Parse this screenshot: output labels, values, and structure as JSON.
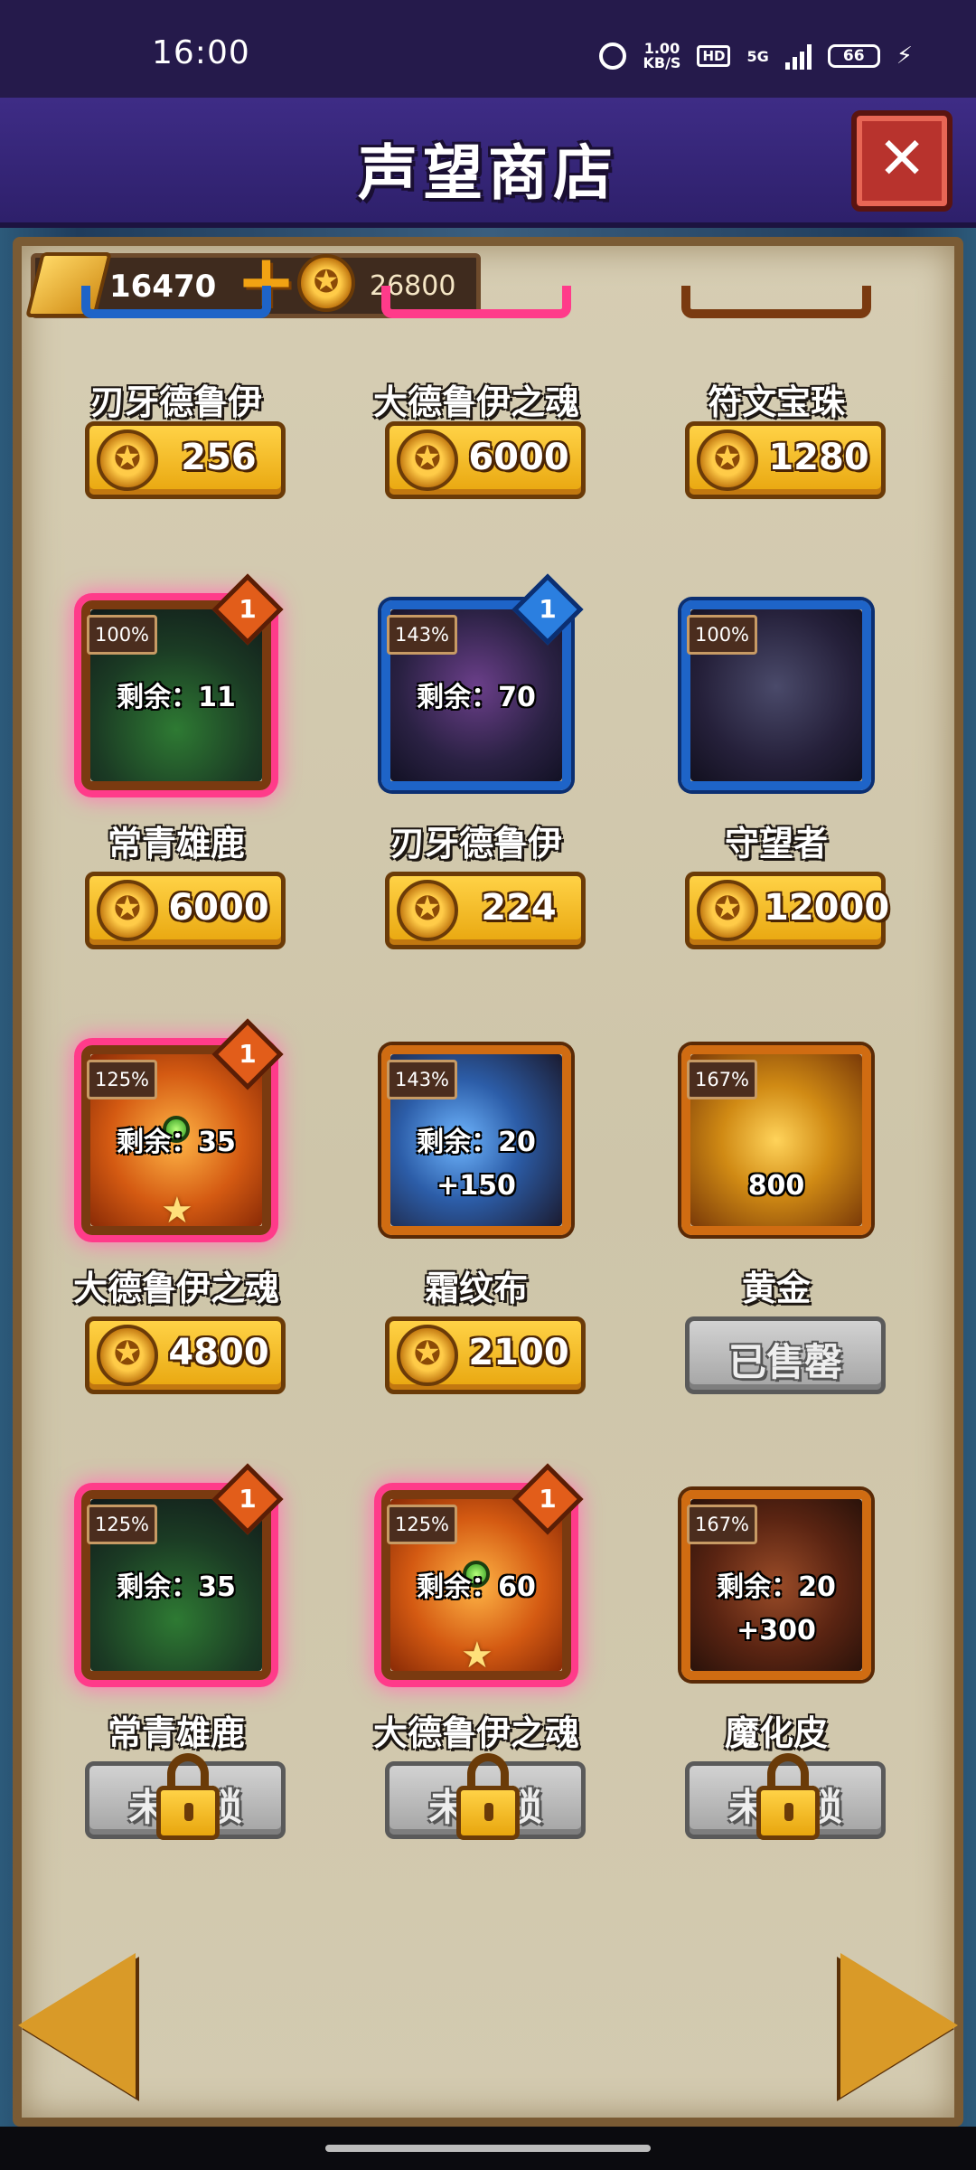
{
  "status": {
    "time": "16:00",
    "speed_value": "1.00",
    "speed_unit": "KB/S",
    "hd": "HD",
    "network": "5G",
    "battery": "66"
  },
  "title": "声望商店",
  "currency": {
    "gold": "16470",
    "coins": "26800"
  },
  "top_row": [
    {
      "name": "刃牙德鲁伊",
      "price": "256"
    },
    {
      "name": "大德鲁伊之魂",
      "price": "6000"
    },
    {
      "name": "符文宝珠",
      "price": "1280"
    }
  ],
  "items": [
    {
      "name": "常青雄鹿",
      "pct": "100%",
      "badge": "1",
      "remain": "剩余：11",
      "price": "6000"
    },
    {
      "name": "刃牙德鲁伊",
      "pct": "143%",
      "badge": "1",
      "remain": "剩余：70",
      "price": "224"
    },
    {
      "name": "守望者",
      "pct": "100%",
      "price": "12000"
    },
    {
      "name": "大德鲁伊之魂",
      "pct": "125%",
      "badge": "1",
      "remain": "剩余：35",
      "price": "4800"
    },
    {
      "name": "霜纹布",
      "pct": "143%",
      "remain": "剩余：20",
      "qty": "+150",
      "price": "2100"
    },
    {
      "name": "黄金",
      "pct": "167%",
      "qty": "800",
      "sold_label": "已售罄"
    },
    {
      "name": "常青雄鹿",
      "pct": "125%",
      "badge": "1",
      "remain": "剩余：35",
      "locked_label": "未解锁"
    },
    {
      "name": "大德鲁伊之魂",
      "pct": "125%",
      "badge": "1",
      "remain": "剩余：60",
      "locked_label": "未解锁"
    },
    {
      "name": "魔化皮",
      "pct": "167%",
      "remain": "剩余：20",
      "qty": "+300",
      "locked_label": "未解锁"
    }
  ],
  "colors": {
    "title_bar": "#3e2c86",
    "gold_button": "#ffd246",
    "glow": "#ff3b8a",
    "parchment": "#d6cdb3"
  },
  "icons": {
    "close": "close-icon",
    "coin": "star-coin-icon",
    "gold": "gold-bar-icon",
    "lock": "lock-icon",
    "prev": "arrow-left-icon",
    "next": "arrow-right-icon"
  }
}
